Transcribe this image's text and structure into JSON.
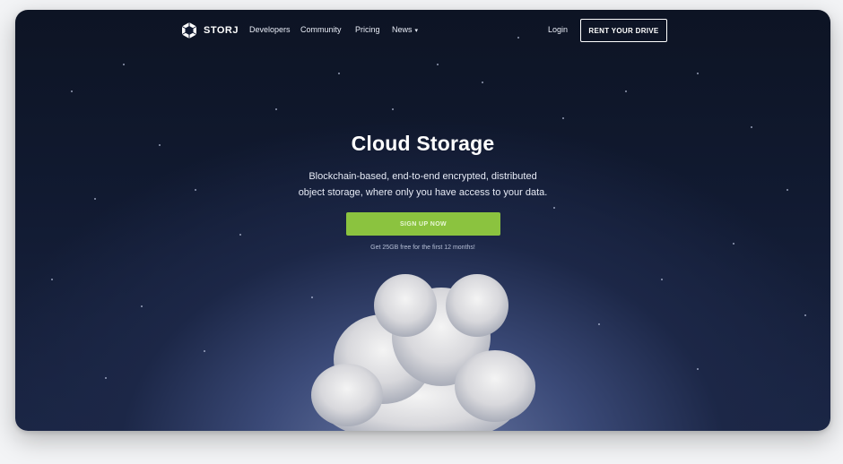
{
  "nav": {
    "brand": "STORJ",
    "links": [
      "Developers",
      "Community",
      "Pricing",
      "News"
    ],
    "login": "Login",
    "cta": "RENT YOUR DRIVE"
  },
  "hero": {
    "title": "Cloud Storage",
    "subtitle_line1": "Blockchain-based, end-to-end encrypted, distributed",
    "subtitle_line2": "object storage, where only you have access to your data.",
    "signup": "SIGN UP NOW",
    "promo": "Get 25GB free for the first 12 months!"
  },
  "colors": {
    "accent_green": "#8bc33f",
    "background_top": "#0d1424",
    "background_glow": "#6b7aa6"
  },
  "icons": {
    "logo": "storj-logo-icon",
    "news_dropdown": "caret-down-icon"
  }
}
